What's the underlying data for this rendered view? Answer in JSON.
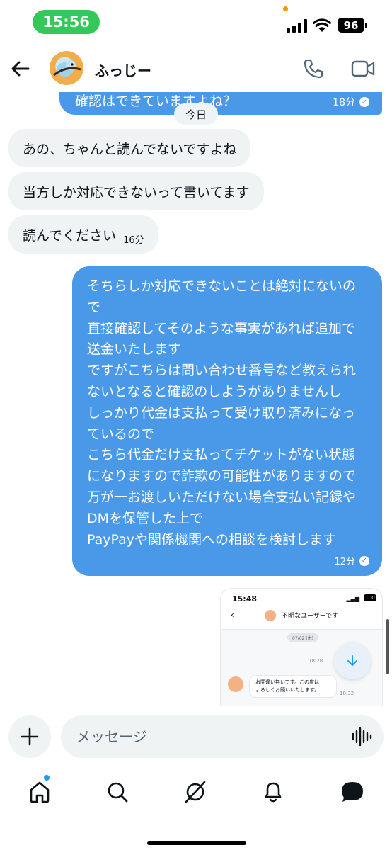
{
  "status_bar": {
    "time": "15:56",
    "battery": "96"
  },
  "header": {
    "contact_name": "ふっじー"
  },
  "messages": {
    "prev_out": {
      "text": "確認はできていますよね？",
      "time": "18分"
    },
    "day_divider": "今日",
    "incoming": [
      {
        "text": "あの、ちゃんと読んでないですよね"
      },
      {
        "text": "当方しか対応できないって書いてます"
      },
      {
        "text": "読んでください",
        "time": "16分"
      }
    ],
    "outgoing_long": {
      "lines": [
        "そちらしか対応できないことは絶対にないの",
        "で",
        "直接確認してそのような事実があれば追加で",
        "送金いたします",
        "ですがこちらは問い合わせ番号など教えられ",
        "ないとなると確認のしようがありませんし",
        "しっかり代金は支払って受け取り済みになっ",
        "ているので",
        "こちら代金だけ支払ってチケットがない状態",
        "になりますので詐欺の可能性がありますので",
        "万が一お渡しいただけない場合支払い記録や",
        "DMを保管した上で",
        "PayPayや関係機関への相談を検討します"
      ],
      "time": "12分"
    },
    "attachment": {
      "time": "15:48",
      "battery": "100",
      "title": "不明なユーザーです",
      "date_pill": "07/02 (木)",
      "sent_time": "18:28",
      "reply_line1": "お間違い無いです。この度は",
      "reply_line2": "よろしくお願いいたします。",
      "reply_time": "18:32"
    }
  },
  "composer": {
    "placeholder": "メッセージ"
  },
  "colors": {
    "bubble_out": "#4a99e9",
    "bubble_in": "#eff3f4",
    "status_green": "#34c759",
    "notif_blue": "#1d9bf0"
  },
  "icons": [
    "back-arrow-icon",
    "phone-icon",
    "video-icon",
    "plus-icon",
    "voice-icon",
    "home-icon",
    "search-icon",
    "grok-icon",
    "bell-icon",
    "messages-icon",
    "scroll-down-icon"
  ]
}
